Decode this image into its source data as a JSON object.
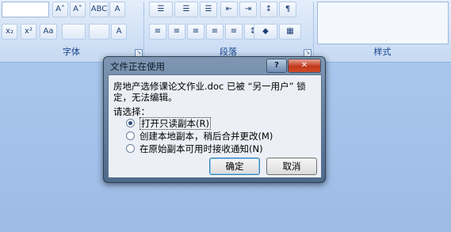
{
  "ribbon": {
    "groups": [
      {
        "label": "字体"
      },
      {
        "label": "段落"
      },
      {
        "label": "样式"
      }
    ],
    "row1": [
      "A˄",
      "A˅",
      "ABC",
      "A"
    ],
    "row2": [
      "x₂",
      "x²",
      "Aa",
      "A"
    ]
  },
  "dialog": {
    "title": "文件正在使用",
    "help": "?",
    "close": "✕",
    "message": "房地产选修课论文作业.doc 已被 “另一用户” 锁定，无法编辑。",
    "prompt": "请选择：",
    "options": [
      {
        "label": "打开只读副本(R)",
        "selected": true
      },
      {
        "label": "创建本地副本，稍后合并更改(M)",
        "selected": false
      },
      {
        "label": "在原始副本可用时接收通知(N)",
        "selected": false
      }
    ],
    "ok_label": "确定",
    "cancel_label": "取消"
  }
}
